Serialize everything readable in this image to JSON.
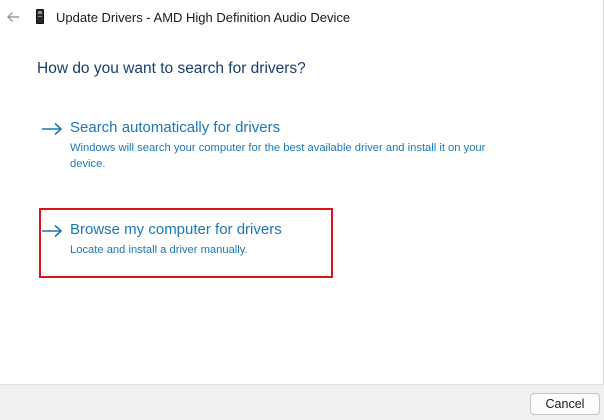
{
  "window": {
    "title": "Update Drivers - AMD High Definition Audio Device"
  },
  "main": {
    "question": "How do you want to search for drivers?",
    "options": [
      {
        "title": "Search automatically for drivers",
        "description": "Windows will search your computer for the best available driver and install it on your device."
      },
      {
        "title": "Browse my computer for drivers",
        "description": "Locate and install a driver manually."
      }
    ]
  },
  "footer": {
    "cancel_label": "Cancel"
  },
  "colors": {
    "link_blue": "#1b78b4",
    "heading_blue": "#1a3d6e",
    "highlight_red": "#d9141a"
  },
  "icons": {
    "back": "back-arrow-icon",
    "device": "device-icon",
    "option_arrow": "right-arrow-icon"
  }
}
